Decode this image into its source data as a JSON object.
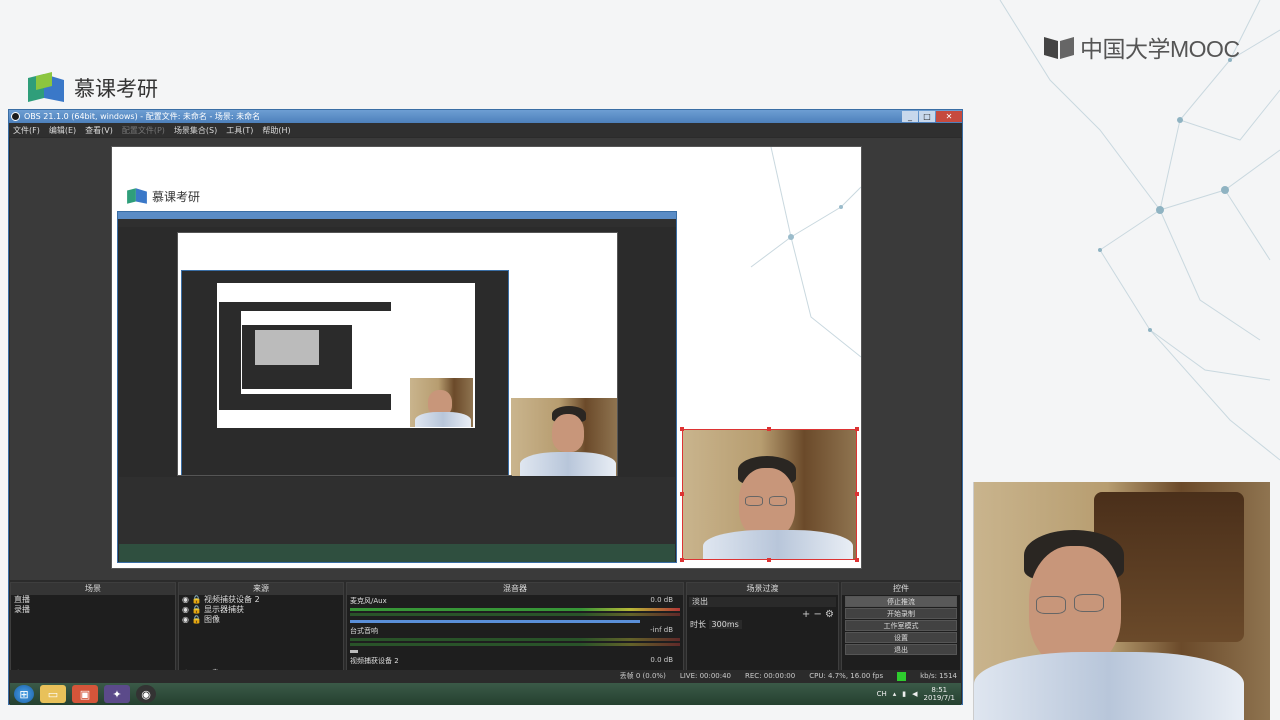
{
  "brand": {
    "mooc_text": "中国大学MOOC",
    "mukao_text": "慕课考研"
  },
  "obs": {
    "title": "OBS 21.1.0 (64bit, windows) - 配置文件: 未命名 - 场景: 未命名",
    "menu": [
      "文件(F)",
      "编辑(E)",
      "查看(V)",
      "配置文件(P)",
      "场景集合(S)",
      "工具(T)",
      "帮助(H)"
    ],
    "window_buttons": {
      "minimize": "_",
      "maximize": "□",
      "close": "✕"
    }
  },
  "docks": {
    "scenes": {
      "header": "场景",
      "items": [
        "直播",
        "录播"
      ]
    },
    "sources": {
      "header": "来源",
      "items": [
        "视频捕获设备 2",
        "显示器捕获",
        "图像"
      ]
    },
    "mixer": {
      "header": "混音器",
      "channels": [
        {
          "name": "麦克风/Aux",
          "db": "0.0 dB"
        },
        {
          "name": "台式音响",
          "db": "-inf dB"
        },
        {
          "name": "视频捕获设备 2",
          "db": "0.0 dB"
        }
      ]
    },
    "transitions": {
      "header": "场景过渡",
      "selected": "淡出",
      "duration_label": "时长",
      "duration_value": "300ms"
    },
    "controls": {
      "header": "控件",
      "buttons": [
        "停止推流",
        "开始录制",
        "工作室模式",
        "设置",
        "退出"
      ]
    }
  },
  "status": {
    "dropped": "丢帧 0 (0.0%)",
    "live": "LIVE: 00:00:40",
    "rec": "REC: 00:00:00",
    "cpu": "CPU: 4.7%, 16.00 fps",
    "kbps": "kb/s: 1514"
  },
  "taskbar": {
    "lang": "CH",
    "time": "8:51",
    "date": "2019/7/1"
  },
  "colors": {
    "obs_bg": "#2b2b2b",
    "accent_blue": "#3a6ea5",
    "selection_red": "#dd3333",
    "status_green": "#2ecc2e"
  }
}
